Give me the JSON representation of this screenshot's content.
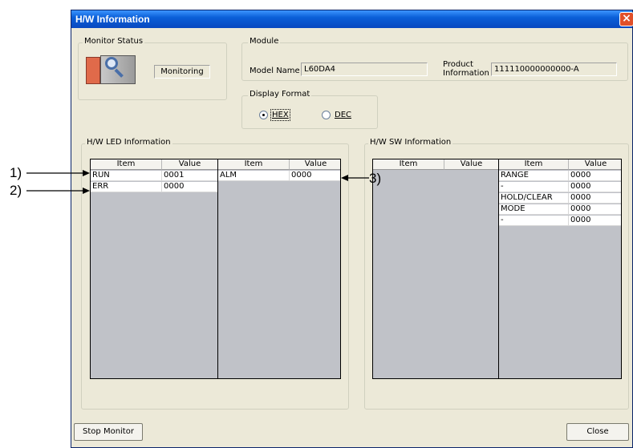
{
  "window": {
    "title": "H/W Information"
  },
  "monitor_status": {
    "group_label": "Monitor Status",
    "status": "Monitoring"
  },
  "module": {
    "group_label": "Module",
    "model_name_label": "Model Name",
    "model_name": "L60DA4",
    "product_info_label_1": "Product",
    "product_info_label_2": "Information",
    "product_info": "111110000000000-A"
  },
  "display_format": {
    "group_label": "Display Format",
    "options": [
      {
        "label": "HEX",
        "selected": true
      },
      {
        "label": "DEC",
        "selected": false
      }
    ]
  },
  "led_info": {
    "group_label": "H/W LED Information",
    "headers": [
      "Item",
      "Value",
      "Item",
      "Value"
    ],
    "left_rows": [
      {
        "item": "RUN",
        "value": "0001"
      },
      {
        "item": "ERR",
        "value": "0000"
      }
    ],
    "right_rows": [
      {
        "item": "ALM",
        "value": "0000"
      }
    ]
  },
  "sw_info": {
    "group_label": "H/W SW Information",
    "headers": [
      "Item",
      "Value",
      "Item",
      "Value"
    ],
    "right_rows": [
      {
        "item": "RANGE",
        "value": "0000"
      },
      {
        "item": "-",
        "value": "0000"
      },
      {
        "item": "HOLD/CLEAR",
        "value": "0000"
      },
      {
        "item": "MODE",
        "value": "0000"
      },
      {
        "item": "-",
        "value": "0000"
      }
    ]
  },
  "buttons": {
    "stop_monitor": "Stop Monitor",
    "close": "Close"
  },
  "callouts": [
    "1)",
    "2)",
    "3)"
  ]
}
